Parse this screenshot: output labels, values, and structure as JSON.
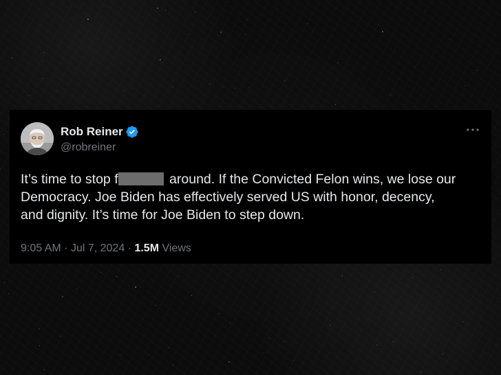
{
  "tweet": {
    "author": {
      "display_name": "Rob Reiner",
      "handle": "@robreiner",
      "verified": true,
      "avatar_icon": "profile-photo"
    },
    "text": {
      "line1_before": "It’s time to stop f",
      "line1_after": " around. If the Convicted Felon wins, we lose our",
      "line2": "Democracy. Joe Biden has effectively served US with honor, decency,",
      "line3": "and dignity. It’s time for Joe Biden to step down."
    },
    "meta": {
      "time": "9:05 AM",
      "separator": "·",
      "date": "Jul 7, 2024",
      "views_count": "1.5M",
      "views_label": "Views"
    },
    "more_icon": "more-horizontal-icon"
  },
  "colors": {
    "background": "#0b0b0b",
    "card": "#000000",
    "text_primary": "#e7e9ea",
    "text_secondary": "#71767b",
    "verified_blue": "#1d9bf0",
    "censor_bar": "#6d6d6d"
  }
}
